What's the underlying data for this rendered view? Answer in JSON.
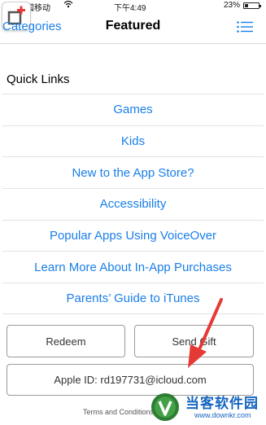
{
  "status_bar": {
    "carrier": "中国移动",
    "time": "下午4:49",
    "battery_percent": "23%",
    "battery_level": 0.23
  },
  "nav": {
    "back_label": "Categories",
    "title": "Featured",
    "list_icon": "list-icon"
  },
  "quick_links": {
    "header": "Quick Links",
    "items": [
      "Games",
      "Kids",
      "New to the App Store?",
      "Accessibility",
      "Popular Apps Using VoiceOver",
      "Learn More About In-App Purchases",
      "Parents’ Guide to iTunes"
    ]
  },
  "buttons": {
    "redeem": "Redeem",
    "send_gift": "Send Gift",
    "apple_id": "Apple ID: rd197731@icloud.com"
  },
  "footer": {
    "terms": "Terms and Conditions"
  },
  "watermark": {
    "title": "当客软件园",
    "url": "www.downkr.com"
  },
  "colors": {
    "accent": "#1a7ee8",
    "arrow": "#e53935",
    "watermark": "#1565c0"
  }
}
